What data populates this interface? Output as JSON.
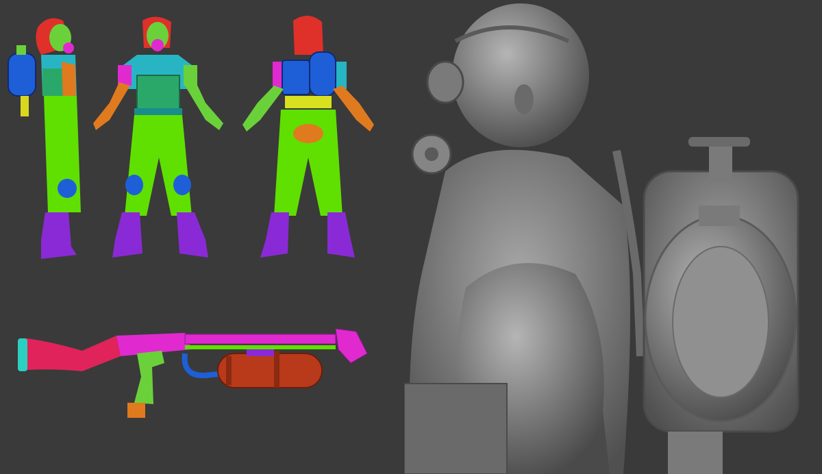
{
  "palette": {
    "background": "#3a3a3a",
    "hair": "#e0302a",
    "skin": "#6bd13a",
    "shirt": "#27b5c4",
    "sleeve": "#e02ad0",
    "arm": "#e07a1f",
    "pants": "#5fe000",
    "boots": "#8a2ad6",
    "vest": "#2aa86a",
    "tank": "#1e5fd8",
    "stock": "#e0235a",
    "fuel_tank": "#b83a1a",
    "sculpt_clay": "#8c8c8c"
  },
  "views": [
    {
      "name": "polypaint-side-view"
    },
    {
      "name": "polypaint-front-view"
    },
    {
      "name": "polypaint-back-view"
    }
  ],
  "panels": {
    "weapon": "flamethrower-polypaint",
    "sculpt": "gasmask-sculpt-closeup"
  }
}
